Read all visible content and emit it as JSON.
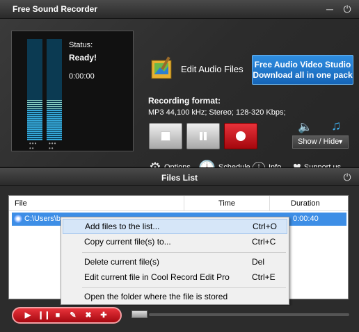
{
  "window": {
    "title": "Free Sound Recorder"
  },
  "status": {
    "label": "Status:",
    "value": "Ready!",
    "time": "0:00:00"
  },
  "meters": {
    "left_level": 0.3,
    "right_level": 0.3
  },
  "edit_audio": {
    "label": "Edit Audio Files"
  },
  "promo": {
    "line1": "Free Audio Video Studio",
    "line2": "Download all in one pack"
  },
  "recording_format": {
    "title": "Recording format:",
    "value": "MP3 44,100 kHz; Stereo;   128-320 Kbps;"
  },
  "transport": {
    "stop_icon": "stop-icon",
    "pause_icon": "pause-icon",
    "record_icon": "record-icon"
  },
  "volume": {
    "showhide_label": "Show / Hide"
  },
  "links": {
    "options": "Options",
    "schedule": "Schedule",
    "info": "Info",
    "support": "Support us"
  },
  "files_list": {
    "title": "Files List",
    "columns": {
      "file": "File",
      "time": "Time",
      "duration": "Duration"
    },
    "rows": [
      {
        "file": "C:\\Users\\b",
        "time": "",
        "duration": "0:00:40"
      }
    ]
  },
  "context_menu": {
    "items": [
      {
        "label": "Add files to the list...",
        "shortcut": "Ctrl+O"
      },
      {
        "label": "Copy current file(s) to...",
        "shortcut": "Ctrl+C"
      },
      {
        "label": "Delete current file(s)",
        "shortcut": "Del"
      },
      {
        "label": "Edit current file in Cool Record Edit Pro",
        "shortcut": "Ctrl+E"
      },
      {
        "label": "Open the folder where the file is stored",
        "shortcut": ""
      }
    ]
  },
  "colors": {
    "accent_blue": "#3d8ee6",
    "record_red": "#c8141b",
    "promo_blue": "#1e78d0"
  }
}
